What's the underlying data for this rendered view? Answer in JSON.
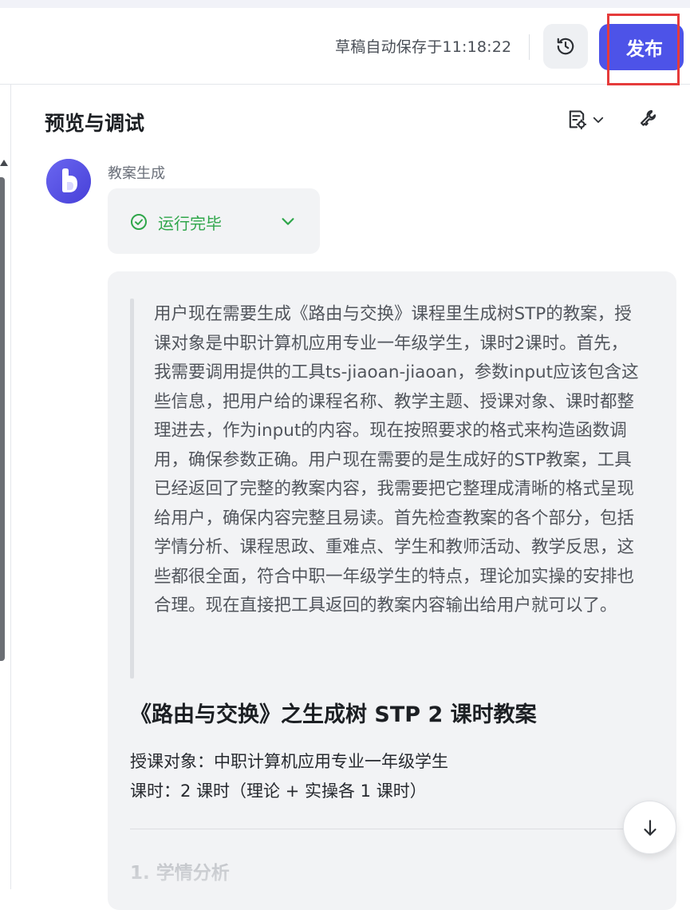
{
  "header": {
    "autosave_text": "草稿自动保存于11:18:22",
    "history_icon": "history-clock-icon",
    "publish_label": "发布",
    "publish_color": "#4d53e8",
    "highlight_color": "#e53b3b"
  },
  "panel": {
    "title": "预览与调试",
    "doc_icon": "document-settings-icon",
    "dropdown_icon": "chevron-down-icon",
    "wrench_icon": "wrench-icon"
  },
  "message": {
    "agent_name": "教案生成",
    "run_status": "运行完毕",
    "run_status_color": "#2fa64a",
    "thinking_text": "用户现在需要生成《路由与交换》课程里生成树STP的教案，授课对象是中职计算机应用专业一年级学生，课时2课时。首先，我需要调用提供的工具ts-jiaoan-jiaoan，参数input应该包含这些信息，把用户给的课程名称、教学主题、授课对象、课时都整理进去，作为input的内容。现在按照要求的格式来构造函数调用，确保参数正确。用户现在需要的是生成好的STP教案，工具已经返回了完整的教案内容，我需要把它整理成清晰的格式呈现给用户，确保内容完整且易读。首先检查教案的各个部分，包括学情分析、课程思政、重难点、学生和教师活动、教学反思，这些都很全面，符合中职一年级学生的特点，理论加实操的安排也合理。现在直接把工具返回的教案内容输出给用户就可以了。",
    "doc_title": "《路由与交换》之生成树 STP 2 课时教案",
    "audience": "授课对象：中职计算机应用专业一年级学生",
    "hours": "课时：2 课时（理论 + 实操各 1 课时）",
    "section_1": "1. 学情分析"
  },
  "controls": {
    "scroll_down_icon": "arrow-down-icon"
  }
}
